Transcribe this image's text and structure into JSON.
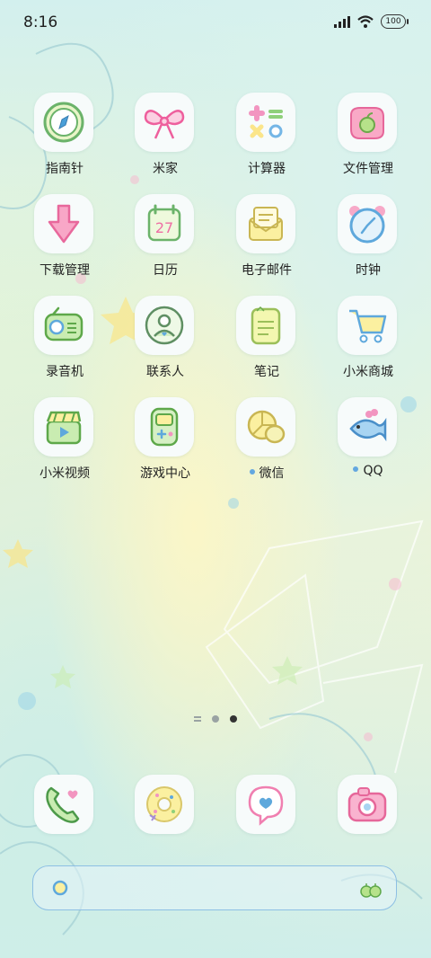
{
  "status": {
    "time": "8:16",
    "battery": "100"
  },
  "apps": [
    {
      "label": "指南针",
      "icon": "compass-icon"
    },
    {
      "label": "米家",
      "icon": "bow-icon"
    },
    {
      "label": "计算器",
      "icon": "calculator-icon"
    },
    {
      "label": "文件管理",
      "icon": "folder-apple-icon"
    },
    {
      "label": "下载管理",
      "icon": "download-arrow-icon"
    },
    {
      "label": "日历",
      "icon": "calendar-icon",
      "calendar_day": "27"
    },
    {
      "label": "电子邮件",
      "icon": "mail-envelope-icon"
    },
    {
      "label": "时钟",
      "icon": "alarm-clock-icon"
    },
    {
      "label": "录音机",
      "icon": "radio-recorder-icon"
    },
    {
      "label": "联系人",
      "icon": "contact-person-icon"
    },
    {
      "label": "笔记",
      "icon": "note-paper-icon"
    },
    {
      "label": "小米商城",
      "icon": "shopping-cart-icon"
    },
    {
      "label": "小米视频",
      "icon": "clapperboard-icon"
    },
    {
      "label": "游戏中心",
      "icon": "game-console-icon"
    },
    {
      "label": "微信",
      "icon": "chat-bubbles-icon",
      "notification_dot": true
    },
    {
      "label": "QQ",
      "icon": "fish-icon",
      "notification_dot": true
    }
  ],
  "dock": [
    {
      "name": "phone-icon"
    },
    {
      "name": "browser-donut-icon"
    },
    {
      "name": "message-heart-icon"
    },
    {
      "name": "camera-icon"
    }
  ],
  "colors": {
    "green": "#7cc576",
    "pink": "#f7a0c6",
    "blue": "#8ec5e8",
    "yellow": "#fbf0a0"
  }
}
